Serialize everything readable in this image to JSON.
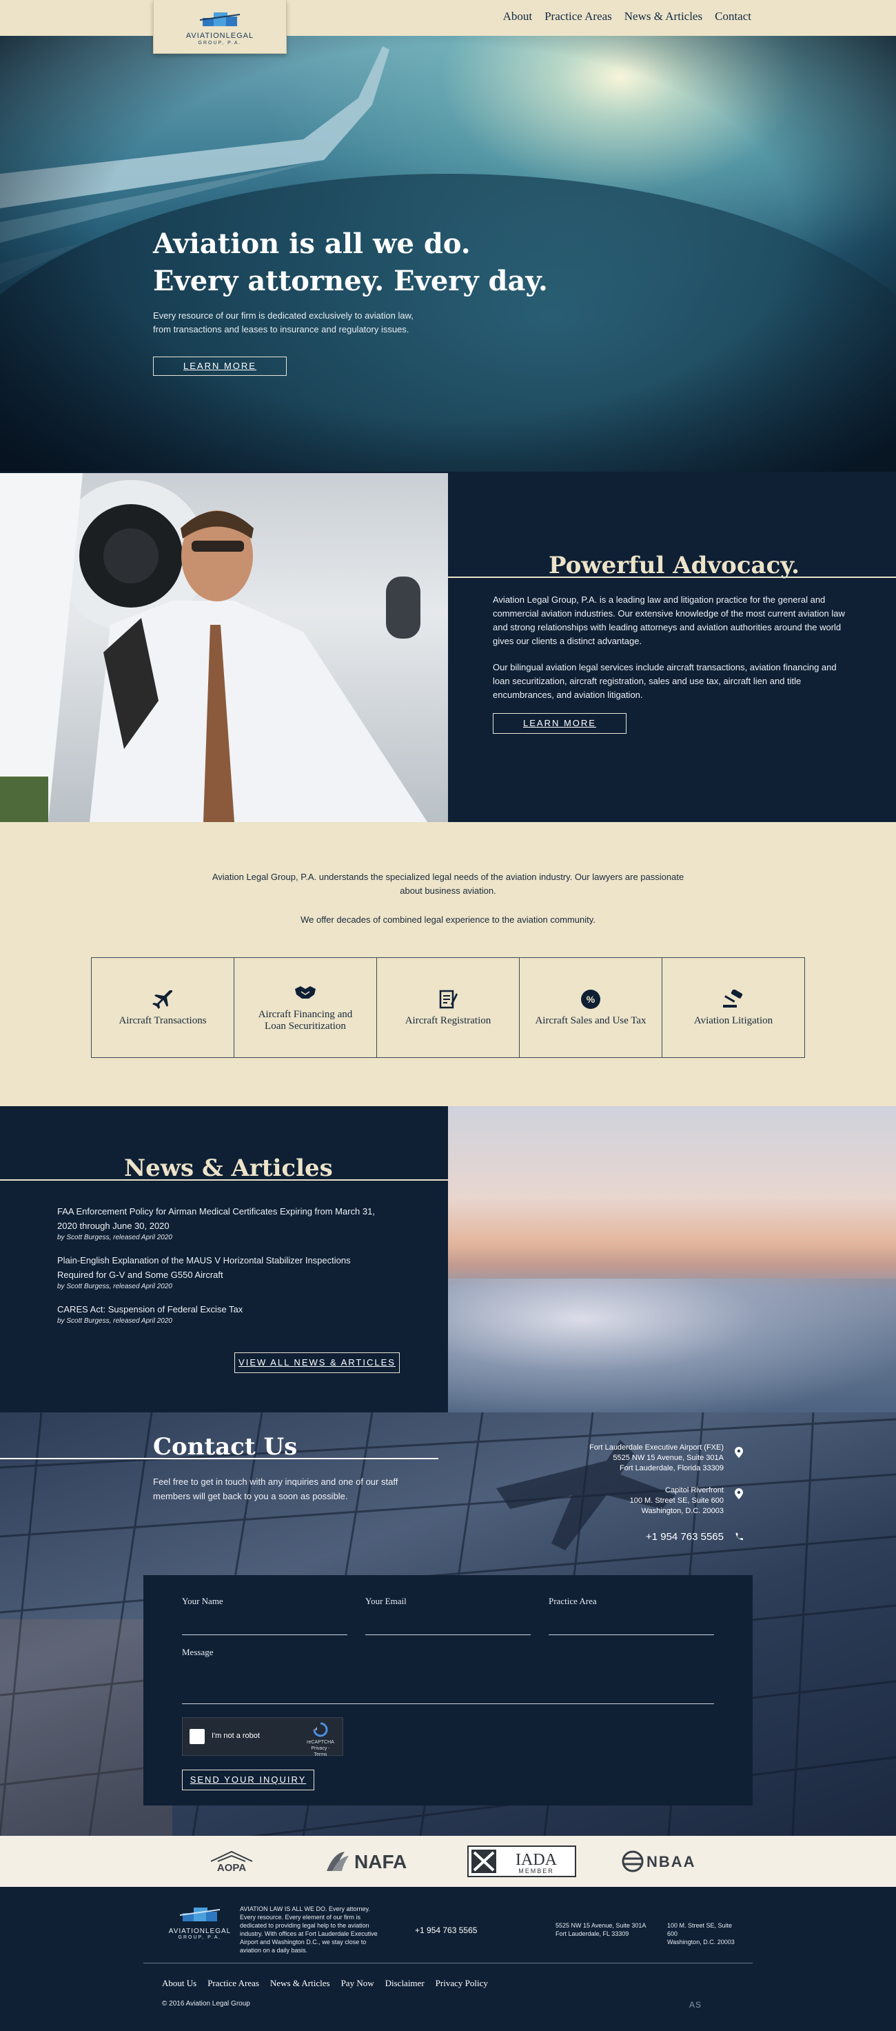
{
  "header": {
    "logo_text": "AVIATIONLEGAL",
    "logo_sub": "GROUP, P.A.",
    "nav": [
      "About",
      "Practice Areas",
      "News & Articles",
      "Contact"
    ]
  },
  "hero": {
    "title_line1": "Aviation is all we do.",
    "title_line2": "Every attorney. Every day.",
    "subtitle_line1": "Every resource of our firm is dedicated exclusively to aviation law,",
    "subtitle_line2": "from transactions and leases to insurance and regulatory issues.",
    "button": "LEARN MORE"
  },
  "advocacy": {
    "title": "Powerful Advocacy.",
    "p1": "Aviation Legal Group, P.A. is a leading law and litigation practice for the general and commercial aviation industries. Our extensive knowledge of the most current aviation law and strong relationships with leading attorneys and aviation authorities around the world gives our clients a distinct advantage.",
    "p2": "Our bilingual aviation legal services include aircraft transactions, aviation financing and loan securitization, aircraft registration, sales and use tax, aircraft lien and title encumbrances, and aviation litigation.",
    "button": "LEARN MORE"
  },
  "practice": {
    "intro": "Aviation Legal Group, P.A. understands the specialized legal needs of the aviation industry. Our lawyers are passionate about business aviation.",
    "intro2": "We offer decades of combined legal experience to the aviation community.",
    "areas": [
      {
        "label": "Aircraft Transactions",
        "icon": "airplane-icon"
      },
      {
        "label": "Aircraft Financing and Loan Securitization",
        "icon": "handshake-icon"
      },
      {
        "label": "Aircraft Registration",
        "icon": "document-icon"
      },
      {
        "label": "Aircraft Sales and Use Tax",
        "icon": "percent-icon"
      },
      {
        "label": "Aviation Litigation",
        "icon": "gavel-icon"
      }
    ]
  },
  "news": {
    "title": "News & Articles",
    "items": [
      {
        "title": "FAA Enforcement Policy for Airman Medical Certificates Expiring from March 31, 2020 through June 30, 2020",
        "meta": "by Scott Burgess, released April 2020"
      },
      {
        "title": "Plain-English Explanation of the MAUS V Horizontal Stabilizer Inspections Required for G-V and Some G550 Aircraft",
        "meta": "by Scott Burgess, released April 2020"
      },
      {
        "title": "CARES Act: Suspension of Federal Excise Tax",
        "meta": "by Scott Burgess, released April 2020"
      }
    ],
    "button": "VIEW ALL NEWS & ARTICLES"
  },
  "contact": {
    "title": "Contact Us",
    "subtitle": "Feel free to get in touch with any inquiries and one of our staff members will get back to you a soon as possible.",
    "office1": [
      "Fort Lauderdale Executive Airport (FXE)",
      "5525 NW 15 Avenue, Suite 301A",
      "Fort Lauderdale, Florida 33309"
    ],
    "office2": [
      "Capitol Riverfront",
      "100 M. Street SE, Suite 600",
      "Washington, D.C. 20003"
    ],
    "phone": "+1 954 763 5565",
    "form": {
      "name_label": "Your Name",
      "email_label": "Your Email",
      "area_label": "Practice Area",
      "message_label": "Message",
      "captcha_text": "I'm not a robot",
      "captcha_brand": "reCAPTCHA",
      "captcha_links": "Privacy - Terms",
      "send": "SEND YOUR INQUIRY"
    }
  },
  "associations": [
    "AOPA",
    "NAFA",
    "IADA",
    "MEMBER",
    "NBAA"
  ],
  "footer": {
    "logo_text": "AVIATIONLEGAL",
    "logo_sub": "GROUP, P.A.",
    "tagline": "AVIATION LAW IS ALL WE DO. Every attorney. Every resource. Every element of our firm is dedicated to providing legal help to the aviation industry. With offices at Fort Lauderdale Executive Airport and Washington D.C., we stay close to aviation on a daily basis.",
    "phone": "+1 954 763 5565",
    "addr1": [
      "5525 NW 15 Avenue, Suite 301A",
      "Fort Lauderdale, FL 33309"
    ],
    "addr2": [
      "100 M. Street SE, Suite",
      "600",
      "Washington, D.C. 20003"
    ],
    "links": [
      "About Us",
      "Practice Areas",
      "News & Articles",
      "Pay Now",
      "Disclaimer",
      "Privacy Policy"
    ],
    "copyright": "© 2016 Aviation Legal Group",
    "credit": "AS"
  },
  "colors": {
    "navy": "#0f2035",
    "cream": "#ede4c9",
    "accent": "#ece3c8"
  }
}
